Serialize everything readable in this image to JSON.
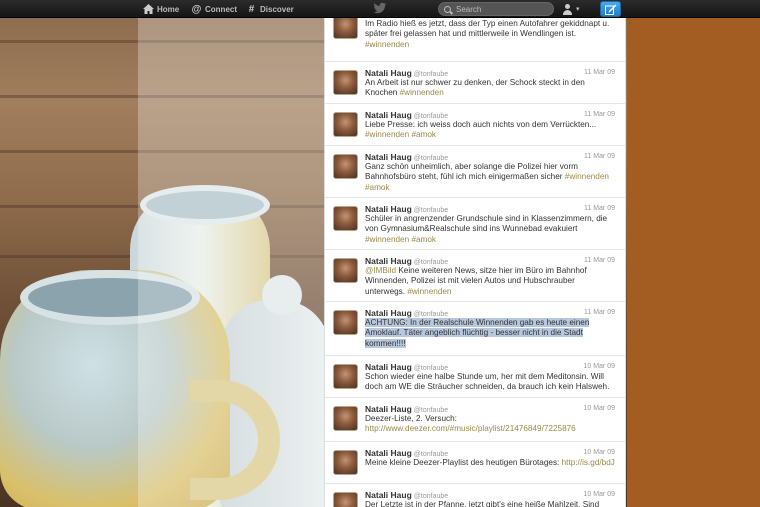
{
  "nav": {
    "home_label": "Home",
    "connect_label": "Connect",
    "discover_label": "Discover",
    "search_placeholder": "Search"
  },
  "colors": {
    "topbar": "#1e1e1e",
    "compose_button": "#2a8ad6",
    "hashtag": "#9a8a4a",
    "highlight": "#b7c7de",
    "side_background": "#a35c22"
  },
  "tweets": [
    {
      "name": "",
      "handle": "",
      "date": "",
      "text_parts": [
        {
          "t": "Im Radio hieß es jetzt, dass der Typ einen Autofahrer gekiddnapt u. später frei gelassen hat und mittlerweile in Wendlingen ist. ",
          "k": "text"
        },
        {
          "t": "#winnenden",
          "k": "tag"
        }
      ]
    },
    {
      "name": "Natali Haug",
      "handle": "@tonfaube",
      "date": "11 Mar 09",
      "text_parts": [
        {
          "t": "An Arbeit ist nur schwer zu denken, der Schock steckt in den Knochen ",
          "k": "text"
        },
        {
          "t": "#winnenden",
          "k": "tag"
        }
      ]
    },
    {
      "name": "Natali Haug",
      "handle": "@tonfaube",
      "date": "11 Mar 09",
      "text_parts": [
        {
          "t": "Liebe Presse: ich weiss doch auch nichts von dem Verrückten... ",
          "k": "text"
        },
        {
          "t": "#winnenden",
          "k": "tag"
        },
        {
          "t": " ",
          "k": "text"
        },
        {
          "t": "#amok",
          "k": "tag"
        }
      ]
    },
    {
      "name": "Natali Haug",
      "handle": "@tonfaube",
      "date": "11 Mar 09",
      "text_parts": [
        {
          "t": "Ganz schön unheimlich, aber solange die Polizei hier vorm Bahnhofsbüro steht, fühl ich mich einigermaßen sicher ",
          "k": "text"
        },
        {
          "t": "#winnenden",
          "k": "tag"
        },
        {
          "t": " ",
          "k": "text"
        },
        {
          "t": "#amok",
          "k": "tag"
        }
      ]
    },
    {
      "name": "Natali Haug",
      "handle": "@tonfaube",
      "date": "11 Mar 09",
      "text_parts": [
        {
          "t": "Schüler in angrenzender Grundschule sind in Klassenzimmern, die von Gymnasium&Realschule sind ins Wunnebad evakuiert ",
          "k": "text"
        },
        {
          "t": "#winnenden",
          "k": "tag"
        },
        {
          "t": " ",
          "k": "text"
        },
        {
          "t": "#amok",
          "k": "tag"
        }
      ]
    },
    {
      "name": "Natali Haug",
      "handle": "@tonfaube",
      "date": "11 Mar 09",
      "text_parts": [
        {
          "t": "@IMBild",
          "k": "tag"
        },
        {
          "t": " Keine weiteren News, sitze hier im Büro im Bahnhof Winnenden, Polizei ist mit vielen Autos und Hubschrauber unterwegs. ",
          "k": "text"
        },
        {
          "t": "#winnenden",
          "k": "tag"
        }
      ]
    },
    {
      "name": "Natali Haug",
      "handle": "@tonfaube",
      "date": "11 Mar 09",
      "text_parts": [
        {
          "t": "ACHTUNG: In der Realschule Winnenden gab es heute einen Amoklauf. Täter angeblich flüchtig - besser nicht in die Stadt kommen!!!!",
          "k": "hl"
        }
      ]
    },
    {
      "name": "Natali Haug",
      "handle": "@tonfaube",
      "date": "10 Mar 09",
      "text_parts": [
        {
          "t": "Schon wieder eine halbe Stunde um, her mit dem Meditonsin. Will doch am WE die Sträucher schneiden, da brauch ich kein Halsweh.",
          "k": "text"
        }
      ]
    },
    {
      "name": "Natali Haug",
      "handle": "@tonfaube",
      "date": "10 Mar 09",
      "text_parts": [
        {
          "t": "Deezer-Liste, 2. Versuch: ",
          "k": "text"
        },
        {
          "t": "http://www.deezer.com/#music/playlist/21476849/7225876",
          "k": "link"
        }
      ]
    },
    {
      "name": "Natali Haug",
      "handle": "@tonfaube",
      "date": "10 Mar 09",
      "text_parts": [
        {
          "t": "Meine kleine Deezer-Playlist des heutigen Bürotages: ",
          "k": "text"
        },
        {
          "t": "http://is.gd/bdJ",
          "k": "link"
        }
      ]
    },
    {
      "name": "Natali Haug",
      "handle": "@tonfaube",
      "date": "10 Mar 09",
      "text_parts": [
        {
          "t": "Der Letzte ist in der Pfanne, jetzt gibt's eine heiße Mahlzeit. Sind aber",
          "k": "text"
        }
      ]
    }
  ]
}
